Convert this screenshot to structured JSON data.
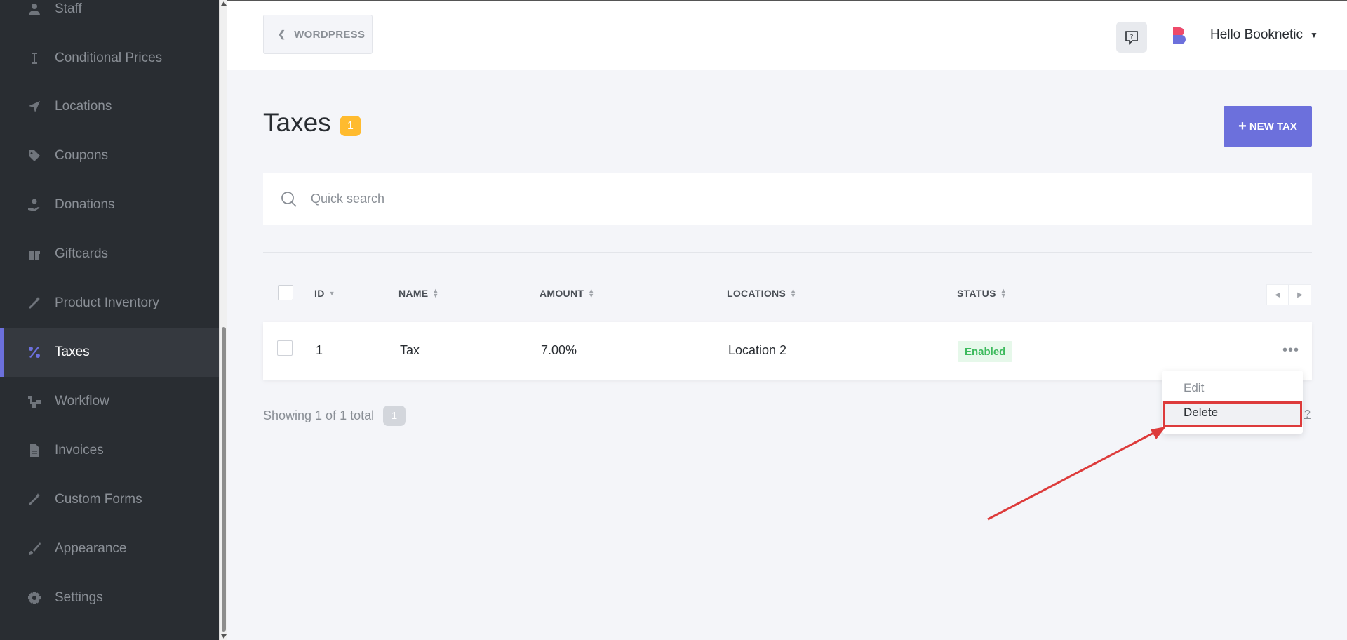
{
  "sidebar": {
    "items": [
      {
        "label": "Staff",
        "icon": "user-icon"
      },
      {
        "label": "Conditional Prices",
        "icon": "cursor-text-icon"
      },
      {
        "label": "Locations",
        "icon": "location-arrow-icon"
      },
      {
        "label": "Coupons",
        "icon": "tag-icon"
      },
      {
        "label": "Donations",
        "icon": "hand-holding-icon"
      },
      {
        "label": "Giftcards",
        "icon": "gift-icon"
      },
      {
        "label": "Product Inventory",
        "icon": "magic-wand-icon"
      },
      {
        "label": "Taxes",
        "icon": "percent-icon",
        "active": true
      },
      {
        "label": "Workflow",
        "icon": "workflow-icon"
      },
      {
        "label": "Invoices",
        "icon": "file-icon"
      },
      {
        "label": "Custom Forms",
        "icon": "magic-wand-icon"
      },
      {
        "label": "Appearance",
        "icon": "brush-icon"
      },
      {
        "label": "Settings",
        "icon": "gear-icon"
      }
    ]
  },
  "header": {
    "back_label": "WORDPRESS",
    "user_label": "Hello Booknetic"
  },
  "page": {
    "title": "Taxes",
    "count": "1",
    "new_button_label": "NEW TAX"
  },
  "search": {
    "placeholder": "Quick search",
    "value": ""
  },
  "table": {
    "columns": [
      "ID",
      "NAME",
      "AMOUNT",
      "LOCATIONS",
      "STATUS"
    ],
    "rows": [
      {
        "id": "1",
        "name": "Tax",
        "amount": "7.00%",
        "locations": "Location 2",
        "status": "Enabled"
      }
    ]
  },
  "row_menu": {
    "items": [
      "Edit",
      "Delete"
    ]
  },
  "footer": {
    "showing_text": "Showing 1 of 1 total",
    "page_badge": "1",
    "link": "?"
  },
  "colors": {
    "accent": "#6c70dc",
    "badge": "#ffbb2f",
    "status_enabled": "#3cba5c",
    "highlight": "#dd3b3b"
  }
}
